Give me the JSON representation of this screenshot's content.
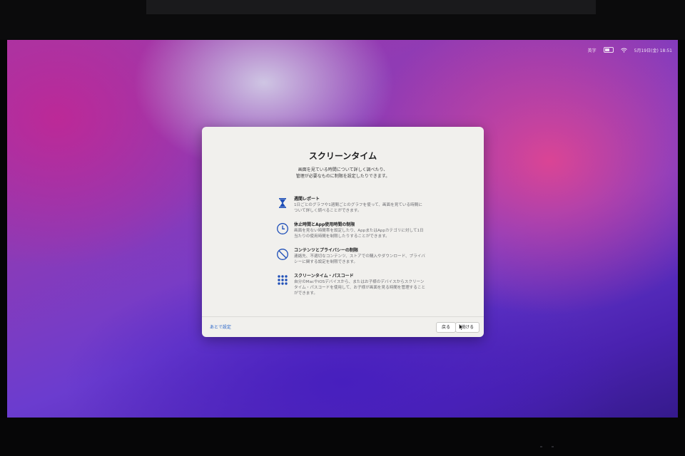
{
  "menubar": {
    "input_source": "英字",
    "date_time": "5月19日(金) 18:51",
    "icons": [
      "battery-icon",
      "wifi-icon"
    ]
  },
  "dialog": {
    "title": "スクリーンタイム",
    "subtitle_line1": "画面を見ている時間について詳しく調べたり、",
    "subtitle_line2": "管理が必要なものに制限を設定したりできます。",
    "features": [
      {
        "icon": "hourglass-icon",
        "title": "週間レポート",
        "desc": "1日ごとのグラフや1週間ごとのグラフを使って、画面を見ている時間について詳しく調べることができます。"
      },
      {
        "icon": "clock-icon",
        "title": "休止時間とApp使用時間の制限",
        "desc": "画面を見ない時間帯を設定したり、AppまたはAppカテゴリに対して1日当たりの使用時間を制限したりすることができます。"
      },
      {
        "icon": "prohibited-icon",
        "title": "コンテンツとプライバシーの制限",
        "desc": "連絡先、不適切なコンテンツ、ストアでの購入やダウンロード、プライバシーに関する設定を制限できます。"
      },
      {
        "icon": "passcode-icon",
        "title": "スクリーンタイム・パスコード",
        "desc": "自分のMacやiOSデバイスから、またはお子様のデバイスからスクリーンタイム・パスコードを使用して、お子様が画面を見る時間を管理することができます。"
      }
    ],
    "later_link": "あとで設定",
    "back_button": "戻る",
    "continue_button": "続ける"
  },
  "colors": {
    "accent": "#2a66c9",
    "icon_blue": "#1f4fb8",
    "dialog_bg": "#f1f0ed"
  }
}
